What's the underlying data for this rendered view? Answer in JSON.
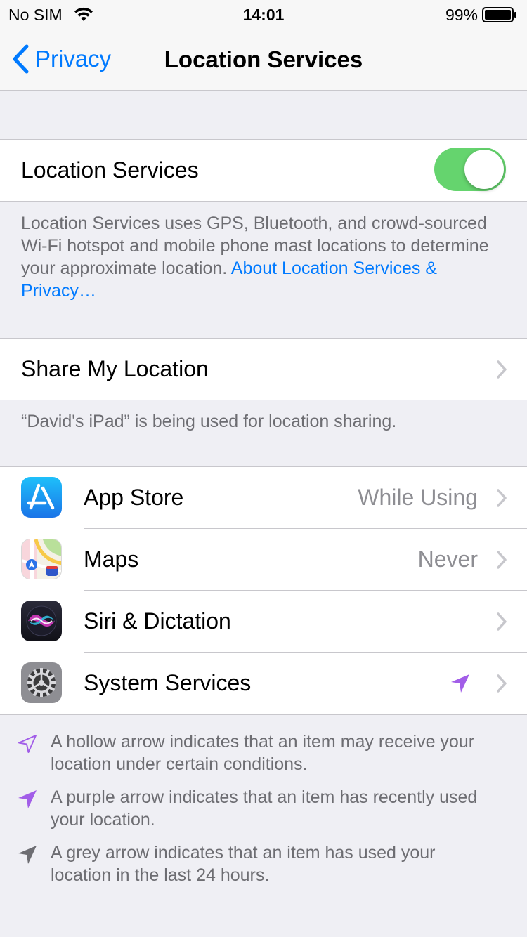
{
  "status_bar": {
    "carrier": "No SIM",
    "time": "14:01",
    "battery": "99%"
  },
  "nav": {
    "back_label": "Privacy",
    "title": "Location Services"
  },
  "location_toggle": {
    "label": "Location Services",
    "on": true
  },
  "location_description": {
    "text": "Location Services uses GPS, Bluetooth, and crowd-sourced Wi-Fi hotspot and mobile phone mast locations to determine your approximate location. ",
    "link": "About Location Services & Privacy…"
  },
  "share_location": {
    "label": "Share My Location",
    "footer": "“David's iPad” is being used for location sharing."
  },
  "apps": [
    {
      "name": "App Store",
      "value": "While Using",
      "icon": "app-store-icon"
    },
    {
      "name": "Maps",
      "value": "Never",
      "icon": "maps-icon"
    },
    {
      "name": "Siri & Dictation",
      "value": "",
      "icon": "siri-icon"
    },
    {
      "name": "System Services",
      "value": "",
      "icon": "settings-gear-icon",
      "indicator": "purple-arrow-icon"
    }
  ],
  "legend": [
    {
      "icon": "hollow-arrow-icon",
      "text": "A hollow arrow indicates that an item may receive your location under certain conditions."
    },
    {
      "icon": "purple-arrow-icon",
      "text": "A purple arrow indicates that an item has recently used your location."
    },
    {
      "icon": "grey-arrow-icon",
      "text": "A grey arrow indicates that an item has used your location in the last 24 hours."
    }
  ],
  "colors": {
    "accent": "#007aff",
    "toggle_on": "#65d46e",
    "purple_arrow": "#a25ee8",
    "grey_arrow": "#8e8e93",
    "background": "#efeff4"
  }
}
